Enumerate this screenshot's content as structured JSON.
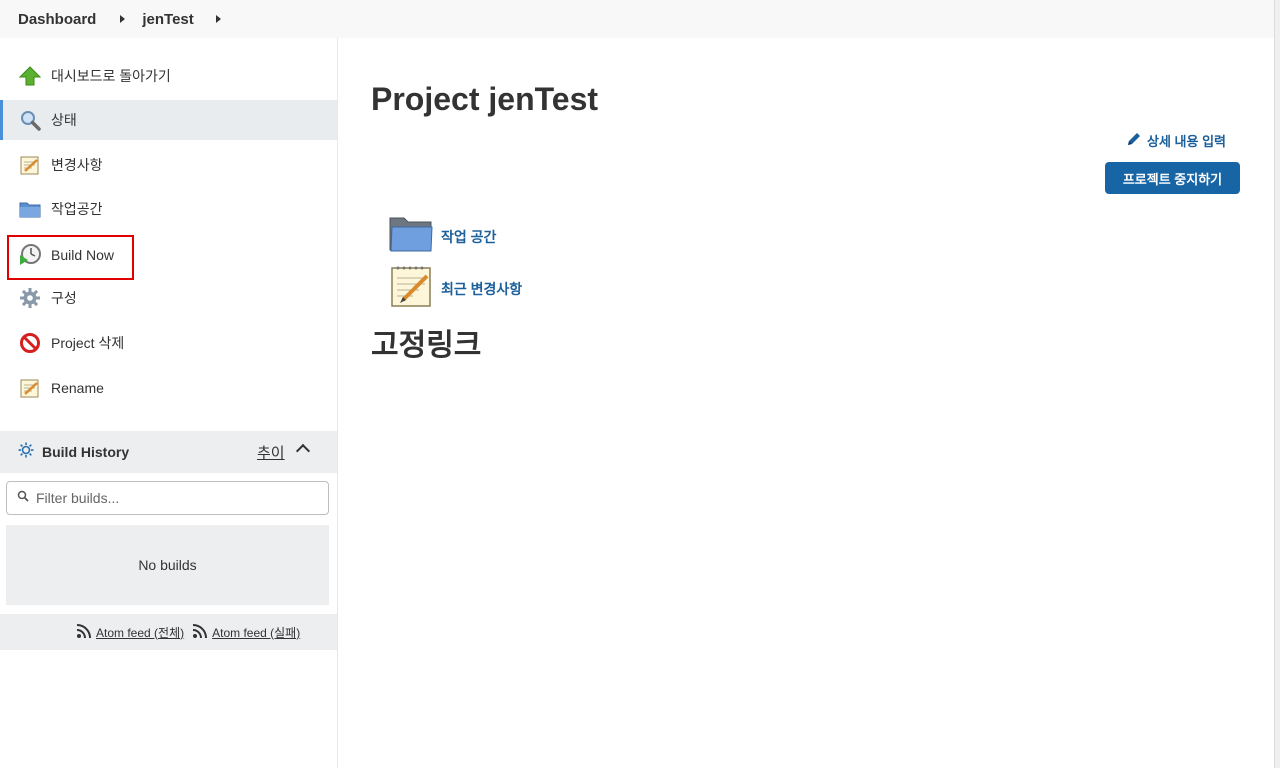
{
  "breadcrumb": {
    "items": [
      "Dashboard",
      "jenTest"
    ]
  },
  "sidebar": {
    "tasks": [
      {
        "label": "대시보드로 돌아가기",
        "icon": "up-arrow-icon"
      },
      {
        "label": "상태",
        "icon": "magnifier-icon"
      },
      {
        "label": "변경사항",
        "icon": "notepad-icon"
      },
      {
        "label": "작업공간",
        "icon": "folder-icon"
      },
      {
        "label": "Build Now",
        "icon": "clock-play-icon"
      },
      {
        "label": "구성",
        "icon": "gear-icon"
      },
      {
        "label": "Project 삭제",
        "icon": "no-entry-icon"
      },
      {
        "label": "Rename",
        "icon": "notepad-icon"
      }
    ],
    "active_index": 1,
    "highlighted_index": 4
  },
  "build_history": {
    "title": "Build History",
    "trend": "추이",
    "filter_placeholder": "Filter builds...",
    "empty_text": "No builds",
    "feeds": [
      "Atom feed (전체)",
      "Atom feed (실패)"
    ]
  },
  "main": {
    "title": "Project jenTest",
    "edit_description": "상세 내용 입력",
    "disable_button": "프로젝트 중지하기",
    "links": [
      {
        "label": "작업 공간",
        "icon": "folder-icon"
      },
      {
        "label": "최근 변경사항",
        "icon": "notepad-icon"
      }
    ],
    "permalinks_heading": "고정링크"
  },
  "colors": {
    "accent": "#1865a6",
    "link": "#1b5f9b",
    "highlight_border": "#e00000",
    "sidebar_active": "#e8ecef"
  }
}
